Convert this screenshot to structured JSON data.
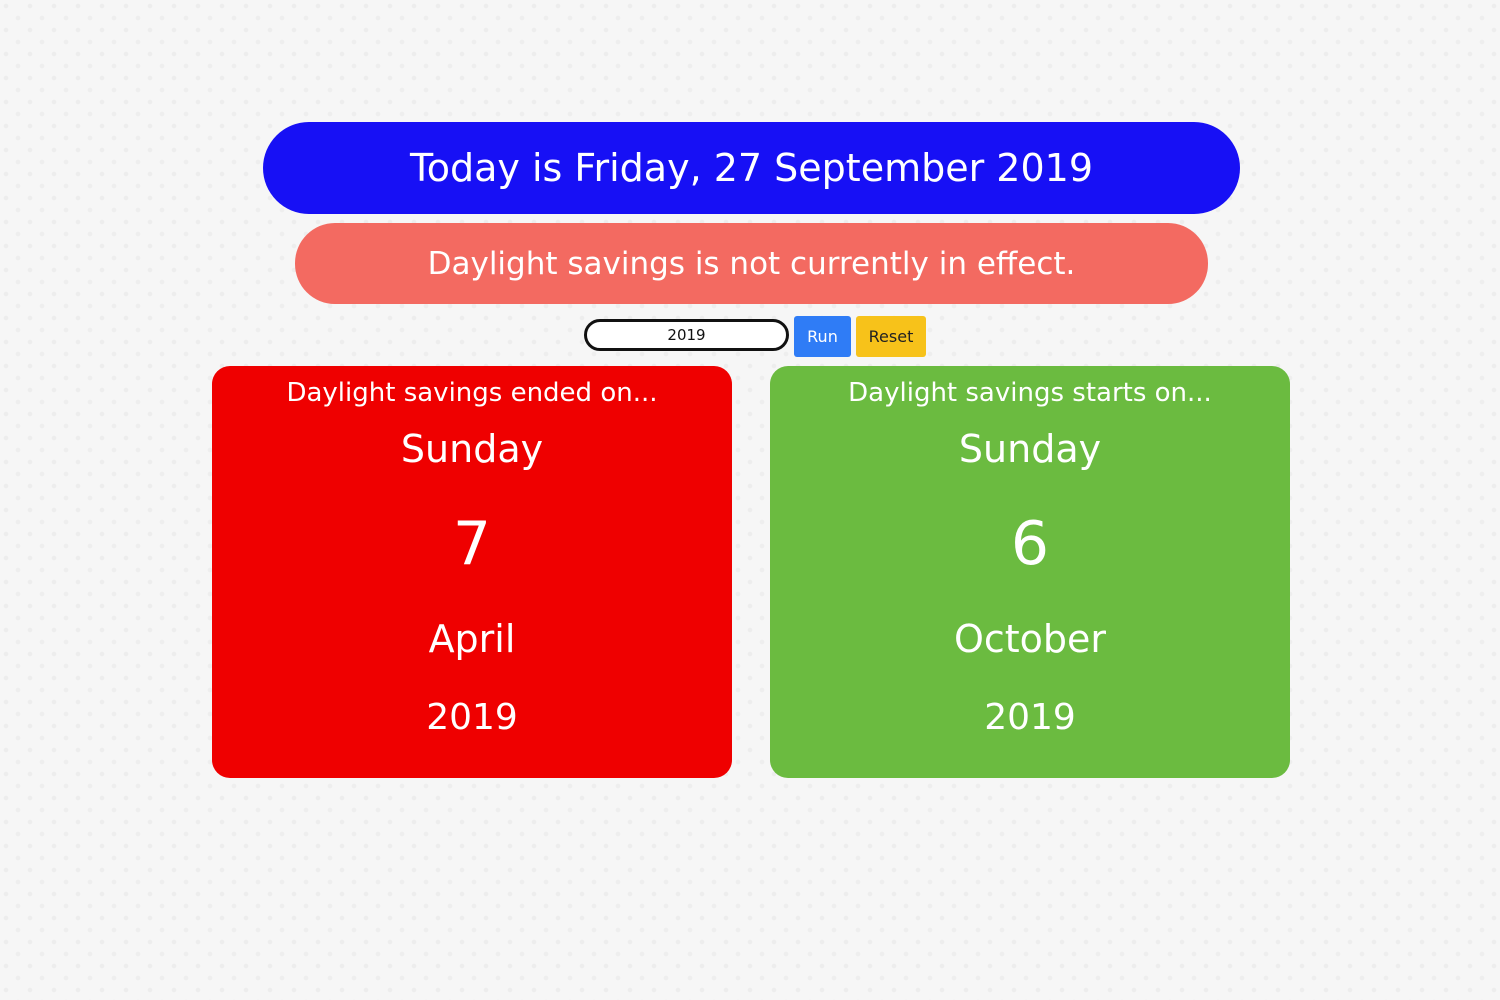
{
  "colors": {
    "today_banner": "#1710f5",
    "status_banner": "#f36a61",
    "ended_card": "#ef0000",
    "starts_card": "#6bbb40",
    "run_button": "#2f7cf6",
    "reset_button": "#f7c21a"
  },
  "today_banner": {
    "text": "Today is Friday, 27 September 2019"
  },
  "status_banner": {
    "text": "Daylight savings is not currently in effect."
  },
  "controls": {
    "year_value": "2019",
    "run_label": "Run",
    "reset_label": "Reset"
  },
  "cards": {
    "ended": {
      "heading": "Daylight savings ended on...",
      "weekday": "Sunday",
      "day": "7",
      "month": "April",
      "year": "2019"
    },
    "starts": {
      "heading": "Daylight savings starts on...",
      "weekday": "Sunday",
      "day": "6",
      "month": "October",
      "year": "2019"
    }
  }
}
